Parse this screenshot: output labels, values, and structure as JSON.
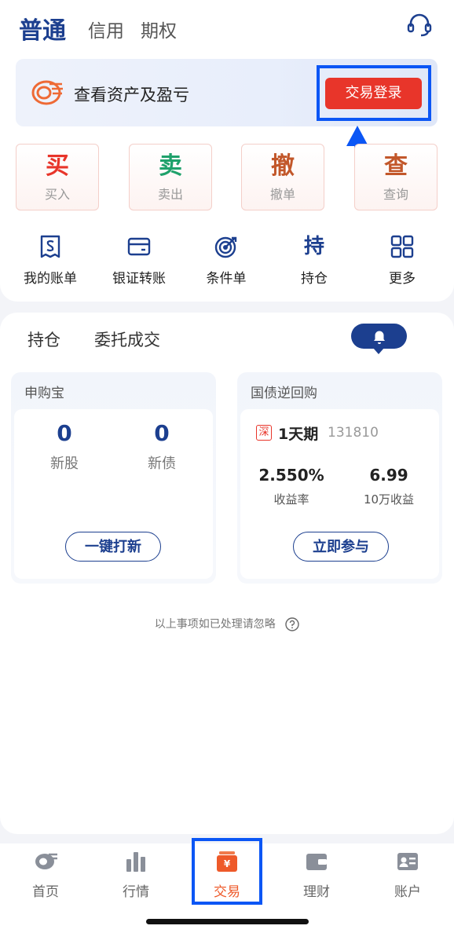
{
  "header": {
    "tabs": [
      {
        "label": "普通",
        "active": true
      },
      {
        "label": "信用",
        "active": false
      },
      {
        "label": "期权",
        "active": false
      }
    ],
    "service_icon": "headset-icon"
  },
  "banner": {
    "text": "查看资产及盈亏",
    "login_label": "交易登录",
    "logo_icon": "brand-logo-icon"
  },
  "trade_actions": [
    {
      "big": "买",
      "small": "买入",
      "color": "#e8352a"
    },
    {
      "big": "卖",
      "small": "卖出",
      "color": "#1fa16b"
    },
    {
      "big": "撤",
      "small": "撤单",
      "color": "#c2572a"
    },
    {
      "big": "查",
      "small": "查询",
      "color": "#c2572a"
    }
  ],
  "quick_links": [
    {
      "label": "我的账单",
      "icon": "bill-icon"
    },
    {
      "label": "银证转账",
      "icon": "card-icon"
    },
    {
      "label": "条件单",
      "icon": "target-icon"
    },
    {
      "label": "持仓",
      "icon": "hold-icon",
      "glyph": "持"
    },
    {
      "label": "更多",
      "icon": "grid-icon"
    }
  ],
  "sub_tabs": [
    "持仓",
    "委托成交"
  ],
  "ipo": {
    "title": "申购宝",
    "new_stock_count": "0",
    "new_stock_label": "新股",
    "new_bond_count": "0",
    "new_bond_label": "新债",
    "button": "一键打新"
  },
  "repo": {
    "title": "国债逆回购",
    "market_tag": "深",
    "term": "1天期",
    "code": "131810",
    "rate": "2.550%",
    "rate_label": "收益率",
    "gain": "6.99",
    "gain_label": "10万收益",
    "button": "立即参与"
  },
  "note": "以上事项如已处理请忽略",
  "bottom_nav": [
    {
      "label": "首页",
      "icon": "home-icon",
      "active": false
    },
    {
      "label": "行情",
      "icon": "chart-icon",
      "active": false
    },
    {
      "label": "交易",
      "icon": "trade-icon",
      "active": true
    },
    {
      "label": "理财",
      "icon": "wallet-icon",
      "active": false
    },
    {
      "label": "账户",
      "icon": "account-icon",
      "active": false
    }
  ],
  "colors": {
    "brand_blue": "#1c3f8f",
    "accent_red": "#e8352a",
    "highlight": "#0b56f5"
  }
}
